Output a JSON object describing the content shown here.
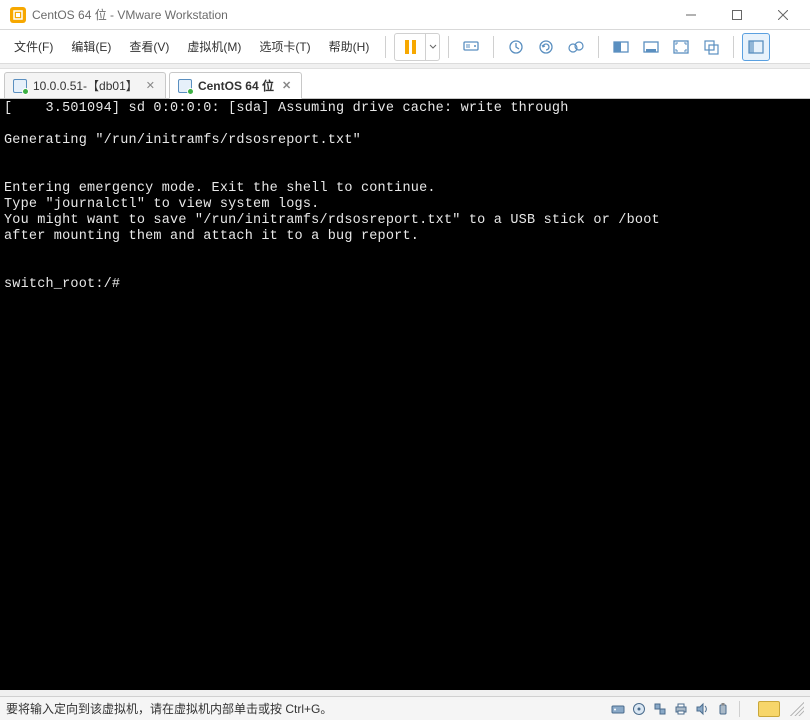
{
  "titlebar": {
    "title": "CentOS 64 位 - VMware Workstation"
  },
  "menu": {
    "file": "文件(F)",
    "edit": "编辑(E)",
    "view": "查看(V)",
    "vm": "虚拟机(M)",
    "tabs": "选项卡(T)",
    "help": "帮助(H)"
  },
  "tabs": [
    {
      "label": "10.0.0.51-【db01】",
      "active": false
    },
    {
      "label": "CentOS 64 位",
      "active": true
    }
  ],
  "console": {
    "lines": [
      "[    3.501094] sd 0:0:0:0: [sda] Assuming drive cache: write through",
      "",
      "Generating \"/run/initramfs/rdsosreport.txt\"",
      "",
      "",
      "Entering emergency mode. Exit the shell to continue.",
      "Type \"journalctl\" to view system logs.",
      "You might want to save \"/run/initramfs/rdsosreport.txt\" to a USB stick or /boot",
      "after mounting them and attach it to a bug report.",
      "",
      "",
      "switch_root:/#"
    ]
  },
  "statusbar": {
    "message": "要将输入定向到该虚拟机，请在虚拟机内部单击或按 Ctrl+G。"
  },
  "icons": {
    "pause": "pause-icon",
    "dropdown": "chevron-down-icon",
    "send": "send-ctrl-alt-del-icon",
    "snap": "snapshot-icon",
    "snap_revert": "snapshot-revert-icon",
    "snap_mgr": "snapshot-manager-icon",
    "fit": "fit-guest-icon",
    "fit_win": "fit-window-icon",
    "full": "fullscreen-icon",
    "unity": "unity-icon",
    "thumb": "thumbnail-icon"
  },
  "status_icons": {
    "hdd": "harddisk-icon",
    "cd": "cdrom-icon",
    "net": "network-icon",
    "print": "printer-icon",
    "sound": "sound-icon",
    "usb": "usb-icon"
  }
}
